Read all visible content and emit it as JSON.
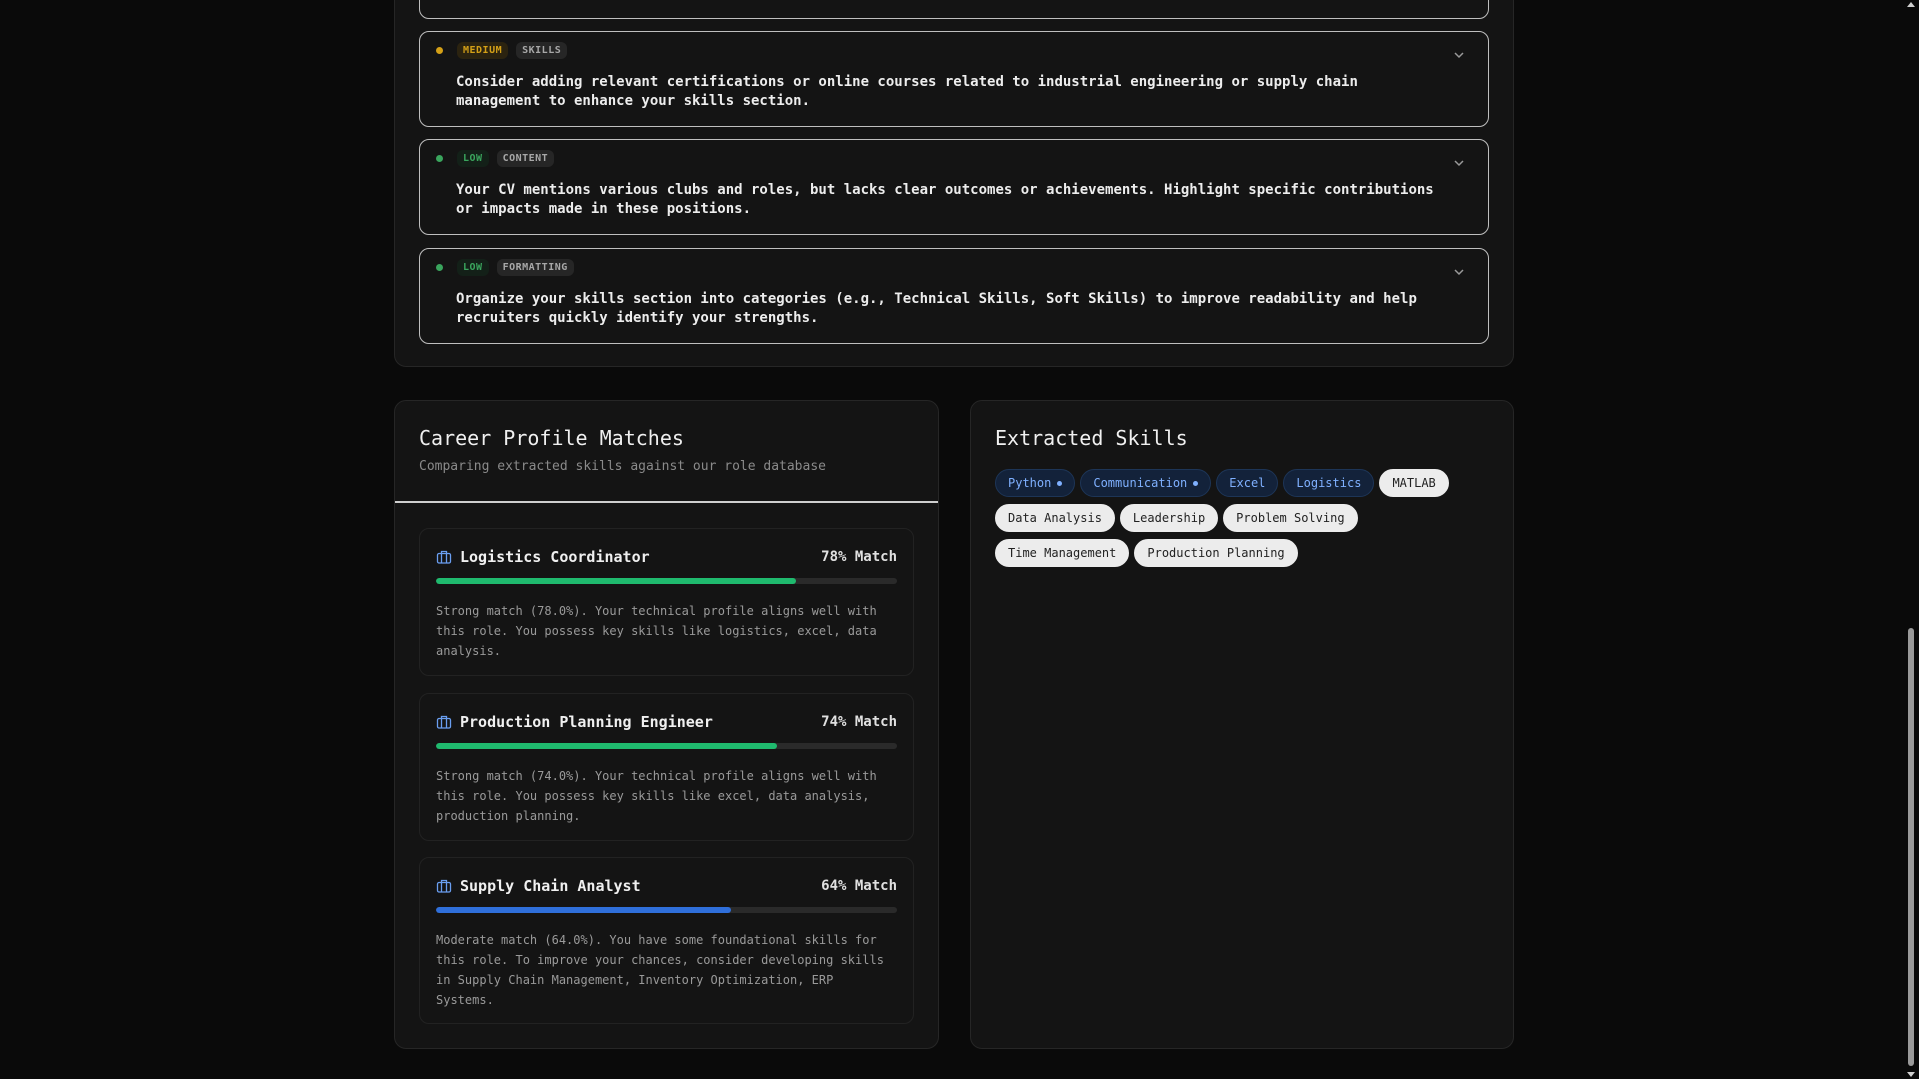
{
  "suggestions": [
    {
      "severity": "MEDIUM",
      "category": "SKILLS",
      "text": "Consider adding relevant certifications or online courses related to industrial engineering or supply chain management to enhance your skills section."
    },
    {
      "severity": "LOW",
      "category": "CONTENT",
      "text": "Your CV mentions various clubs and roles, but lacks clear outcomes or achievements. Highlight specific contributions or impacts made in these positions."
    },
    {
      "severity": "LOW",
      "category": "FORMATTING",
      "text": "Organize your skills section into categories (e.g., Technical Skills, Soft Skills) to improve readability and help recruiters quickly identify your strengths."
    }
  ],
  "career": {
    "title": "Career Profile Matches",
    "subtitle": "Comparing extracted skills against our role database",
    "matches": [
      {
        "role": "Logistics Coordinator",
        "match_label": "78% Match",
        "match_fraction": 0.78,
        "bar_color": "#1fba6e",
        "description": "Strong match (78.0%). Your technical profile aligns well with this role. You possess key skills like logistics, excel, data analysis."
      },
      {
        "role": "Production Planning Engineer",
        "match_label": "74% Match",
        "match_fraction": 0.74,
        "bar_color": "#1fba6e",
        "description": "Strong match (74.0%). Your technical profile aligns well with this role. You possess key skills like excel, data analysis, production planning."
      },
      {
        "role": "Supply Chain Analyst",
        "match_label": "64% Match",
        "match_fraction": 0.64,
        "bar_color": "#2f6fdb",
        "description": "Moderate match (64.0%). You have some foundational skills for this role. To improve your chances, consider developing skills in Supply Chain Management, Inventory Optimization, ERP Systems."
      }
    ]
  },
  "skills": {
    "title": "Extracted Skills",
    "items": [
      {
        "label": "Python",
        "style": "blue",
        "dot": true
      },
      {
        "label": "Communication",
        "style": "blue",
        "dot": true
      },
      {
        "label": "Excel",
        "style": "blue",
        "dot": false
      },
      {
        "label": "Logistics",
        "style": "blue",
        "dot": false
      },
      {
        "label": "MATLAB",
        "style": "white",
        "dot": false
      },
      {
        "label": "Data Analysis",
        "style": "white",
        "dot": false
      },
      {
        "label": "Leadership",
        "style": "white",
        "dot": false
      },
      {
        "label": "Problem Solving",
        "style": "white",
        "dot": false
      },
      {
        "label": "Time Management",
        "style": "white",
        "dot": false
      },
      {
        "label": "Production Planning",
        "style": "white",
        "dot": false
      }
    ]
  },
  "icons": {
    "chevron": "chevron-down-icon",
    "briefcase": "briefcase-icon"
  },
  "colors": {
    "medium": "#d4a017",
    "low": "#3aa55d"
  }
}
